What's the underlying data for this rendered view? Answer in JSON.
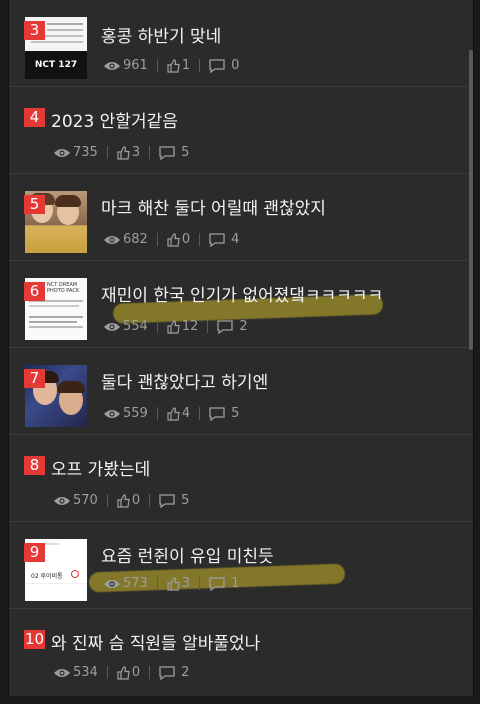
{
  "posts": [
    {
      "rank": "3",
      "title": "홍콩 하반기 맞네",
      "views": "961",
      "likes": "1",
      "comments": "0",
      "thumb_text": "NCT 127"
    },
    {
      "rank": "4",
      "title": "2023 안할거같음",
      "views": "735",
      "likes": "3",
      "comments": "5"
    },
    {
      "rank": "5",
      "title": "마크 해찬 둘다 어릴때 괜찮았지",
      "views": "682",
      "likes": "0",
      "comments": "4"
    },
    {
      "rank": "6",
      "title": "재민이 한국 인기가 없어졌댘ㅋㅋㅋㅋㅋ",
      "views": "554",
      "likes": "12",
      "comments": "2",
      "thumb_text": "NCT DREAM PHOTO PACK"
    },
    {
      "rank": "7",
      "title": "둘다 괜찮았다고 하기엔",
      "views": "559",
      "likes": "4",
      "comments": "5"
    },
    {
      "rank": "8",
      "title": "오프 가봤는데",
      "views": "570",
      "likes": "0",
      "comments": "5"
    },
    {
      "rank": "9",
      "title": "요즘 런쥔이 유입 미친듯",
      "views": "573",
      "likes": "3",
      "comments": "1",
      "thumb_text": "02 루이비통"
    },
    {
      "rank": "10",
      "title": "와 진짜 슴 직원들 알바풀었나",
      "views": "534",
      "likes": "0",
      "comments": "2"
    }
  ],
  "icons": {
    "views": "eye-icon",
    "likes": "thumbs-up-icon",
    "comments": "comment-icon"
  },
  "colors": {
    "rank_badge": "#e53935",
    "background": "#2b2b2b",
    "highlight": "#beaa28"
  }
}
